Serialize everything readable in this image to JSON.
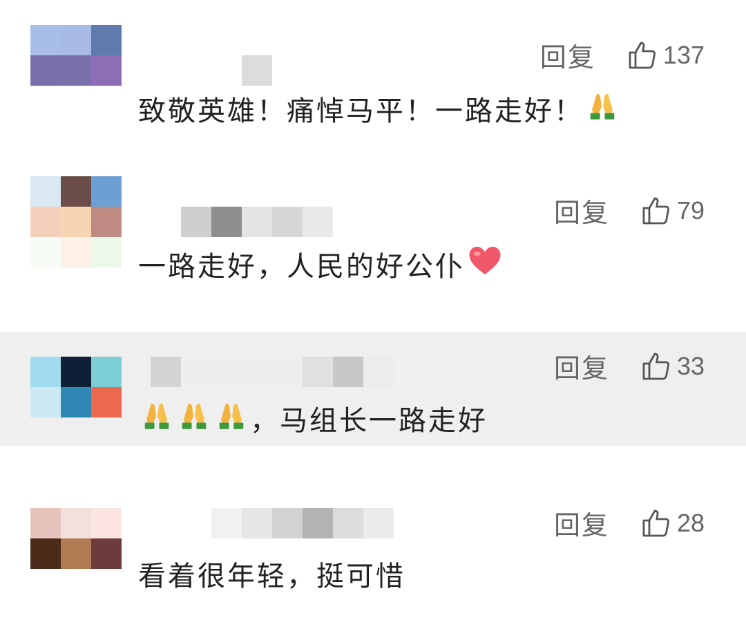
{
  "comments": [
    {
      "text": "致敬英雄！痛悼马平！一路走好！",
      "emoji_after": [
        "folded-hands"
      ],
      "reply_label": "回复",
      "like_count": "137",
      "highlighted": false
    },
    {
      "text": "一路走好，人民的好公仆",
      "emoji_after": [
        "red-heart"
      ],
      "reply_label": "回复",
      "like_count": "79",
      "highlighted": false
    },
    {
      "text_before_emoji": "",
      "text": "，马组长一路走好",
      "emoji_before": [
        "folded-hands",
        "folded-hands",
        "folded-hands"
      ],
      "reply_label": "回复",
      "like_count": "33",
      "highlighted": true
    },
    {
      "text": "看着很年轻，挺可惜",
      "reply_label": "回复",
      "like_count": "28",
      "highlighted": false
    }
  ],
  "icons": {
    "like": "thumbs-up-outline-icon",
    "pray": "folded-hands-icon",
    "heart": "red-heart-icon"
  },
  "colors": {
    "highlight_bg": "#efefef",
    "meta_text": "#666666",
    "body_text": "#222222"
  }
}
